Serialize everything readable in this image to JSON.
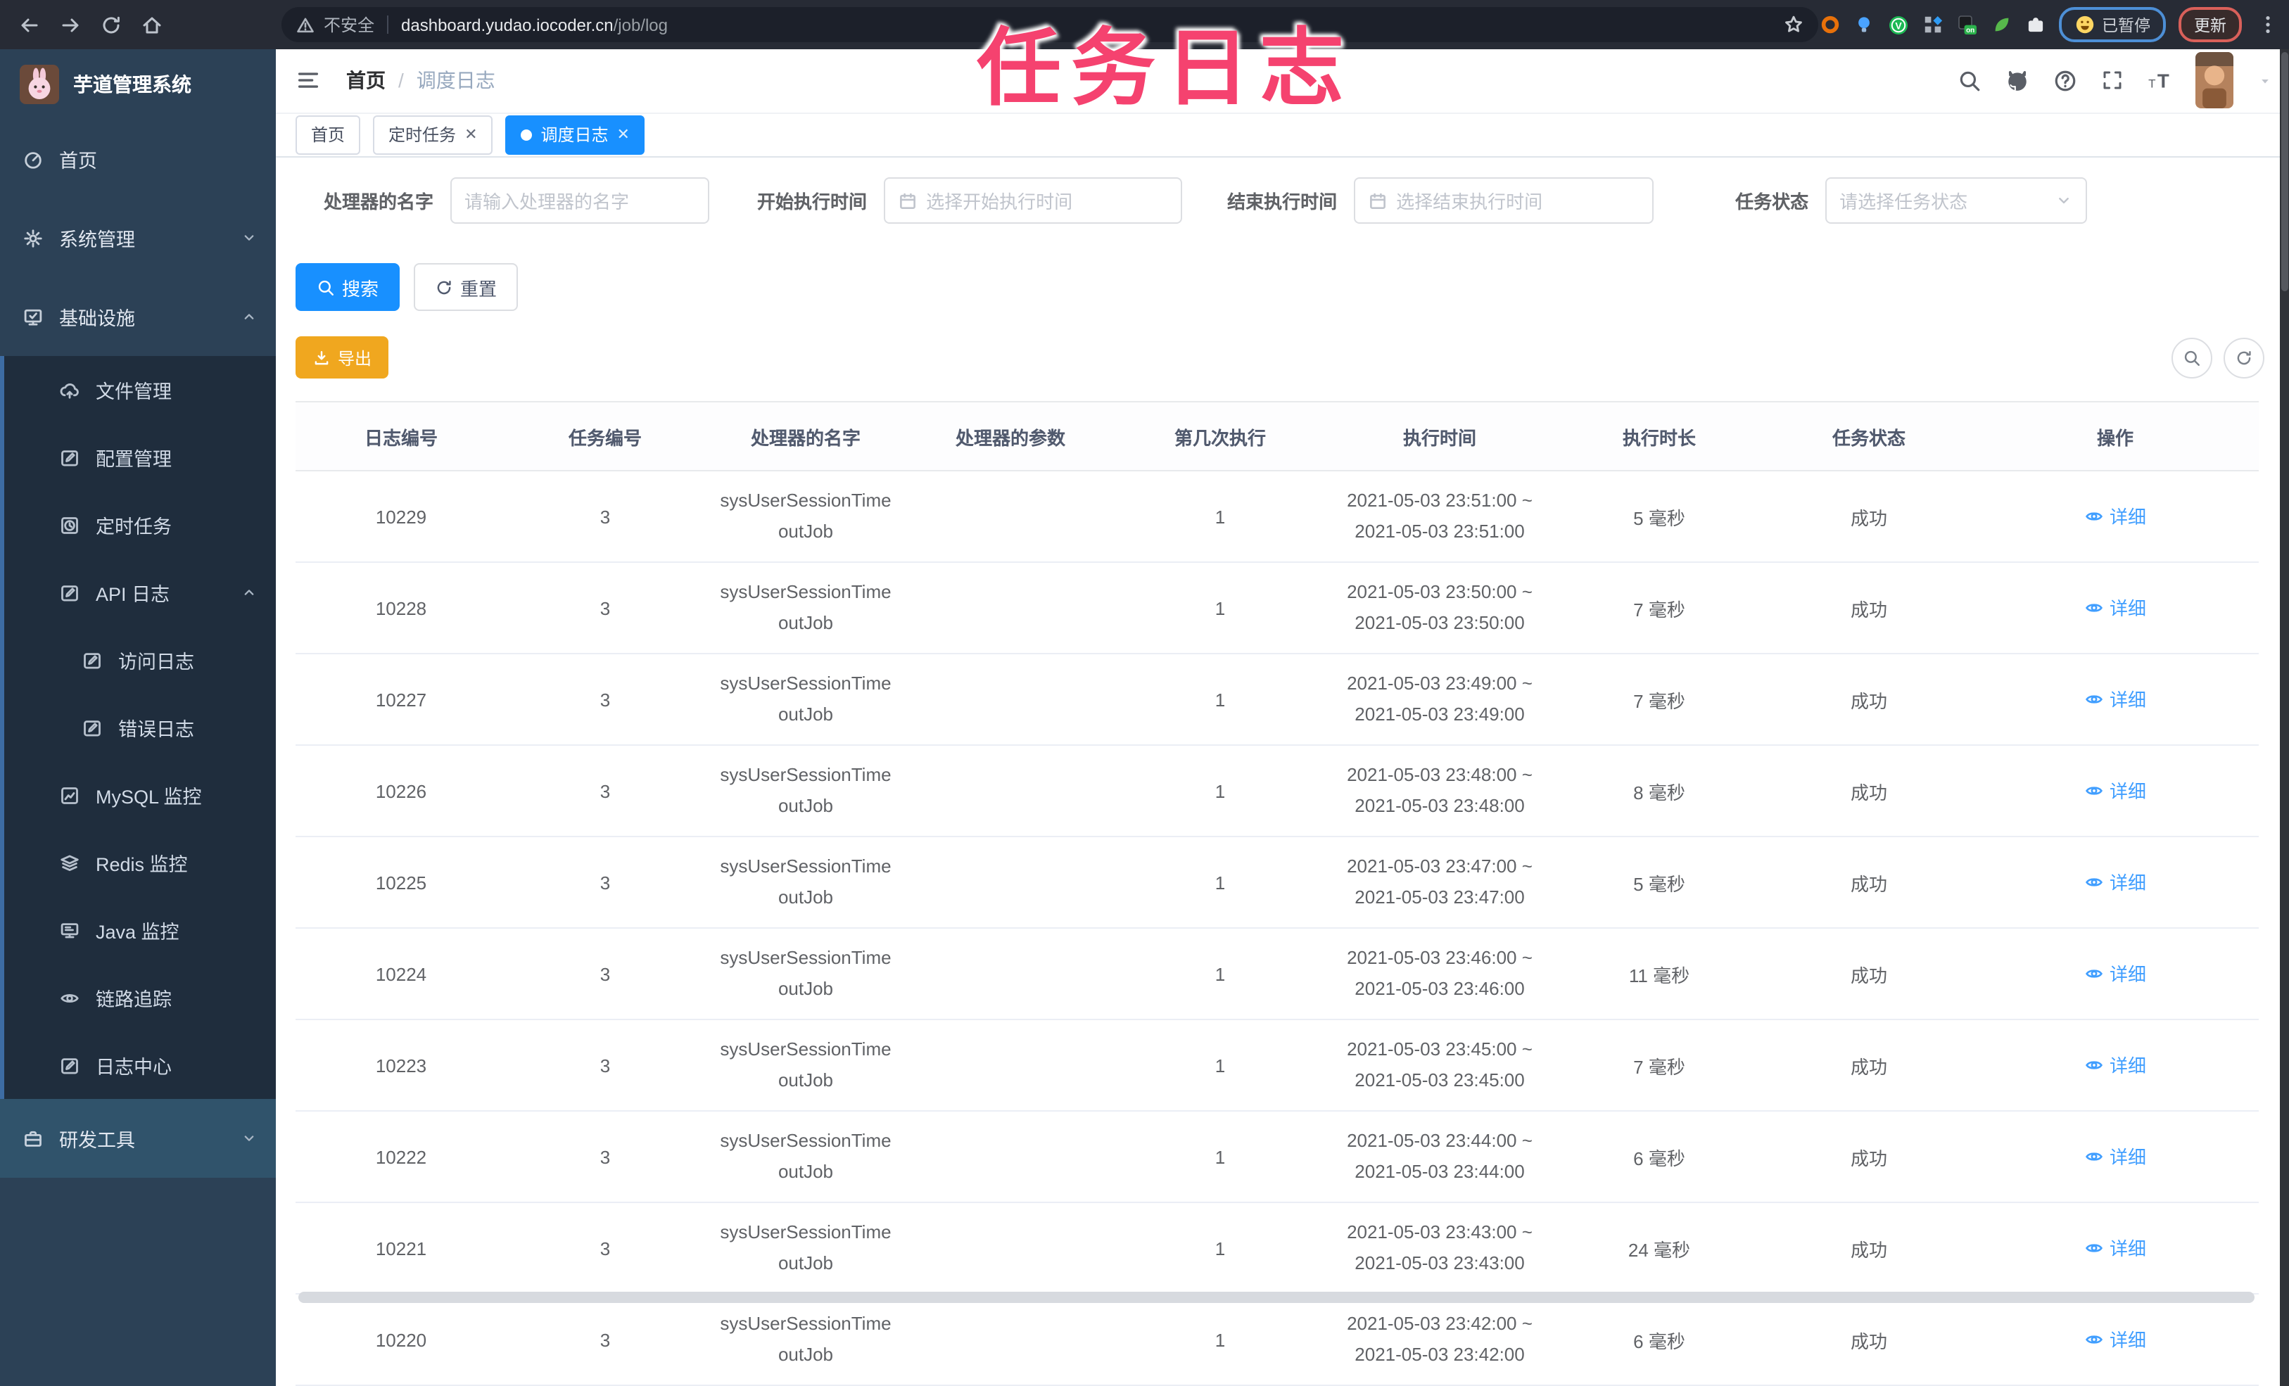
{
  "browser": {
    "security_label": "不安全",
    "url_host": "dashboard.yudao.iocoder.cn",
    "url_path": "/job/log",
    "paused_badge": "已暂停",
    "update_button": "更新",
    "nav_icons": [
      "back-icon",
      "forward-icon",
      "reload-icon",
      "home-icon"
    ],
    "ext_icons": [
      "orange-ring-icon",
      "bulb-icon",
      "v-circle-icon",
      "grid-diamond-icon",
      "on-badge-icon",
      "leaf-icon",
      "puzzle-icon"
    ]
  },
  "overlay_title": "任务日志",
  "app_title": "芋道管理系统",
  "navbar": {
    "breadcrumb_home": "首页",
    "breadcrumb_current": "调度日志",
    "icons": [
      "search-icon",
      "github-icon",
      "question-icon",
      "fullscreen-icon",
      "font-size-icon"
    ]
  },
  "tags": [
    {
      "label": "首页",
      "active": false,
      "closable": false
    },
    {
      "label": "定时任务",
      "active": false,
      "closable": true
    },
    {
      "label": "调度日志",
      "active": true,
      "closable": true
    }
  ],
  "sidebar": {
    "items": [
      {
        "label": "首页",
        "icon": "dashboard-icon",
        "level": 1,
        "section": "top"
      },
      {
        "label": "系统管理",
        "icon": "gear-icon",
        "level": 1,
        "chevron": "down",
        "section": "top"
      },
      {
        "label": "基础设施",
        "icon": "monitor-check-icon",
        "level": 1,
        "chevron": "up",
        "section": "top"
      },
      {
        "label": "文件管理",
        "icon": "cloud-upload-icon",
        "level": 2,
        "section": "sub"
      },
      {
        "label": "配置管理",
        "icon": "edit-icon",
        "level": 2,
        "section": "sub"
      },
      {
        "label": "定时任务",
        "icon": "timer-icon",
        "level": 2,
        "section": "sub"
      },
      {
        "label": "API 日志",
        "icon": "edit-icon",
        "level": 2,
        "chevron": "up",
        "section": "sub"
      },
      {
        "label": "访问日志",
        "icon": "edit-icon",
        "level": 3,
        "section": "sub"
      },
      {
        "label": "错误日志",
        "icon": "edit-icon",
        "level": 3,
        "section": "sub"
      },
      {
        "label": "MySQL 监控",
        "icon": "chart-icon",
        "level": 2,
        "section": "sub"
      },
      {
        "label": "Redis 监控",
        "icon": "layers-icon",
        "level": 2,
        "section": "sub"
      },
      {
        "label": "Java 监控",
        "icon": "screen-icon",
        "level": 2,
        "section": "sub"
      },
      {
        "label": "链路追踪",
        "icon": "eye-icon",
        "level": 2,
        "section": "sub"
      },
      {
        "label": "日志中心",
        "icon": "edit-icon",
        "level": 2,
        "section": "sub"
      },
      {
        "label": "研发工具",
        "icon": "toolbox-icon",
        "level": 1,
        "chevron": "down",
        "section": "bottom"
      }
    ]
  },
  "filters": [
    {
      "label": "处理器的名字",
      "placeholder": "请输入处理器的名字",
      "type": "text"
    },
    {
      "label": "开始执行时间",
      "placeholder": "选择开始执行时间",
      "type": "date"
    },
    {
      "label": "结束执行时间",
      "placeholder": "选择结束执行时间",
      "type": "date"
    },
    {
      "label": "任务状态",
      "placeholder": "请选择任务状态",
      "type": "select"
    }
  ],
  "actions": {
    "search": "搜索",
    "reset": "重置",
    "export": "导出"
  },
  "table": {
    "headers": [
      "日志编号",
      "任务编号",
      "处理器的名字",
      "处理器的参数",
      "第几次执行",
      "执行时间",
      "执行时长",
      "任务状态",
      "操作"
    ],
    "detail_label": "详细",
    "rows": [
      {
        "log_id": "10229",
        "job_id": "3",
        "handler": "sysUserSessionTimeoutJob",
        "param": "",
        "count": "1",
        "start": "2021-05-03 23:51:00",
        "end": "2021-05-03 23:51:00",
        "duration": "5 毫秒",
        "status": "成功"
      },
      {
        "log_id": "10228",
        "job_id": "3",
        "handler": "sysUserSessionTimeoutJob",
        "param": "",
        "count": "1",
        "start": "2021-05-03 23:50:00",
        "end": "2021-05-03 23:50:00",
        "duration": "7 毫秒",
        "status": "成功"
      },
      {
        "log_id": "10227",
        "job_id": "3",
        "handler": "sysUserSessionTimeoutJob",
        "param": "",
        "count": "1",
        "start": "2021-05-03 23:49:00",
        "end": "2021-05-03 23:49:00",
        "duration": "7 毫秒",
        "status": "成功"
      },
      {
        "log_id": "10226",
        "job_id": "3",
        "handler": "sysUserSessionTimeoutJob",
        "param": "",
        "count": "1",
        "start": "2021-05-03 23:48:00",
        "end": "2021-05-03 23:48:00",
        "duration": "8 毫秒",
        "status": "成功"
      },
      {
        "log_id": "10225",
        "job_id": "3",
        "handler": "sysUserSessionTimeoutJob",
        "param": "",
        "count": "1",
        "start": "2021-05-03 23:47:00",
        "end": "2021-05-03 23:47:00",
        "duration": "5 毫秒",
        "status": "成功"
      },
      {
        "log_id": "10224",
        "job_id": "3",
        "handler": "sysUserSessionTimeoutJob",
        "param": "",
        "count": "1",
        "start": "2021-05-03 23:46:00",
        "end": "2021-05-03 23:46:00",
        "duration": "11 毫秒",
        "status": "成功"
      },
      {
        "log_id": "10223",
        "job_id": "3",
        "handler": "sysUserSessionTimeoutJob",
        "param": "",
        "count": "1",
        "start": "2021-05-03 23:45:00",
        "end": "2021-05-03 23:45:00",
        "duration": "7 毫秒",
        "status": "成功"
      },
      {
        "log_id": "10222",
        "job_id": "3",
        "handler": "sysUserSessionTimeoutJob",
        "param": "",
        "count": "1",
        "start": "2021-05-03 23:44:00",
        "end": "2021-05-03 23:44:00",
        "duration": "6 毫秒",
        "status": "成功"
      },
      {
        "log_id": "10221",
        "job_id": "3",
        "handler": "sysUserSessionTimeoutJob",
        "param": "",
        "count": "1",
        "start": "2021-05-03 23:43:00",
        "end": "2021-05-03 23:43:00",
        "duration": "24 毫秒",
        "status": "成功"
      },
      {
        "log_id": "10220",
        "job_id": "3",
        "handler": "sysUserSessionTimeoutJob",
        "param": "",
        "count": "1",
        "start": "2021-05-03 23:42:00",
        "end": "2021-05-03 23:42:00",
        "duration": "6 毫秒",
        "status": "成功"
      }
    ]
  }
}
